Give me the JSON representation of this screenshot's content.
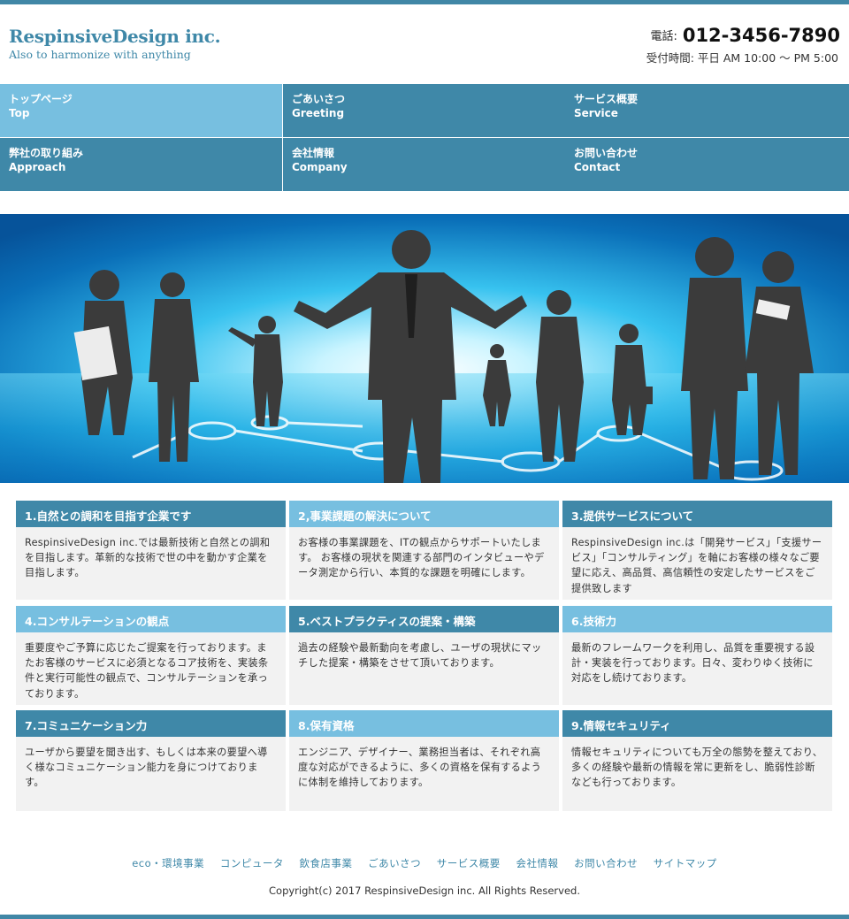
{
  "header": {
    "logo": "RespinsiveDesign inc.",
    "tagline": "Also to harmonize with anything",
    "tel_label": "電話:",
    "tel_number": "012-3456-7890",
    "hours": "受付時間: 平日 AM 10:00 〜 PM 5:00"
  },
  "nav": {
    "items": [
      {
        "ja": "トップページ",
        "en": "Top"
      },
      {
        "ja": "ごあいさつ",
        "en": "Greeting"
      },
      {
        "ja": "サービス概要",
        "en": "Service"
      },
      {
        "ja": "弊社の取り組み",
        "en": "Approach"
      },
      {
        "ja": "会社情報",
        "en": "Company"
      },
      {
        "ja": "お問い合わせ",
        "en": "Contact"
      }
    ]
  },
  "boxes": [
    {
      "title": "1.自然との調和を目指す企業です",
      "body": "RespinsiveDesign inc.では最新技術と自然との調和を目指します。革新的な技術で世の中を動かす企業を目指します。"
    },
    {
      "title": "2,事業課題の解決について",
      "body": "お客様の事業課題を、ITの観点からサポートいたします。 お客様の現状を関連する部門のインタビューやデータ測定から行い、本質的な課題を明確にします。"
    },
    {
      "title": "3.提供サービスについて",
      "body": "RespinsiveDesign inc.は「開発サービス」「支援サービス」「コンサルティング」を軸にお客様の様々なご要望に応え、高品質、高信頼性の安定したサービスをご提供致します"
    },
    {
      "title": "4.コンサルテーションの観点",
      "body": "重要度やご予算に応じたご提案を行っております。またお客様のサービスに必須となるコア技術を、実装条件と実行可能性の観点で、コンサルテーションを承っております。"
    },
    {
      "title": "5.ベストプラクティスの提案・構築",
      "body": "過去の経験や最新動向を考慮し、ユーザの現状にマッチした提案・構築をさせて頂いております。"
    },
    {
      "title": "6.技術力",
      "body": "最新のフレームワークを利用し、品質を重要視する設計・実装を行っております。日々、変わりゆく技術に対応をし続けております。"
    },
    {
      "title": "7.コミュニケーション力",
      "body": "ユーザから要望を聞き出す、もしくは本来の要望へ導く様なコミュニケーション能力を身につけております。"
    },
    {
      "title": "8.保有資格",
      "body": "エンジニア、デザイナー、業務担当者は、それぞれ高度な対応ができるように、多くの資格を保有するように体制を維持しております。"
    },
    {
      "title": "9.情報セキュリティ",
      "body": "情報セキュリティについても万全の態勢を整えており、多くの経験や最新の情報を常に更新をし、脆弱性診断なども行っております。"
    }
  ],
  "footer": {
    "links": [
      "eco・環境事業",
      "コンピュータ",
      "飲食店事業",
      "ごあいさつ",
      "サービス概要",
      "会社情報",
      "お問い合わせ",
      "サイトマップ"
    ],
    "copyright": "Copyright(c) 2017 RespinsiveDesign inc. All Rights Reserved."
  },
  "colors": {
    "primary": "#3f88a8",
    "accent_light": "#77bfe0",
    "box_bg": "#f2f2f2"
  },
  "hero": {
    "image": "business-people-silhouettes-on-network"
  }
}
